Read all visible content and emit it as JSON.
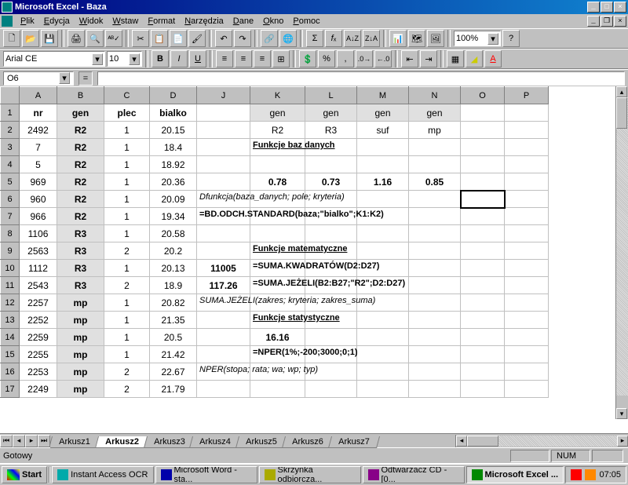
{
  "window": {
    "title": "Microsoft Excel - Baza"
  },
  "menu": {
    "items": [
      "Plik",
      "Edycja",
      "Widok",
      "Wstaw",
      "Format",
      "Narzędzia",
      "Dane",
      "Okno",
      "Pomoc"
    ]
  },
  "toolbar": {
    "font": "Arial CE",
    "size": "10",
    "zoom": "100%"
  },
  "formula": {
    "namebox": "O6",
    "formula": ""
  },
  "columns": [
    "A",
    "B",
    "C",
    "D",
    "J",
    "K",
    "L",
    "M",
    "N",
    "O",
    "P"
  ],
  "rows": [
    {
      "r": 1,
      "A": "nr",
      "B": "gen",
      "C": "plec",
      "D": "bialko",
      "K": "gen",
      "L": "gen",
      "M": "gen",
      "N": "gen",
      "hdr": true
    },
    {
      "r": 2,
      "A": "2492",
      "B": "R2",
      "C": "1",
      "D": "20.15",
      "K": "R2",
      "L": "R3",
      "M": "suf",
      "N": "mp"
    },
    {
      "r": 3,
      "A": "7",
      "B": "R2",
      "C": "1",
      "D": "18.4",
      "K": "Funkcje baz danych",
      "Kbu": true
    },
    {
      "r": 4,
      "A": "5",
      "B": "R2",
      "C": "1",
      "D": "18.92"
    },
    {
      "r": 5,
      "A": "969",
      "B": "R2",
      "C": "1",
      "D": "20.36",
      "K": "0.78",
      "L": "0.73",
      "M": "1.16",
      "N": "0.85",
      "Kb": true,
      "Lb": true,
      "Mb": true,
      "Nb": true
    },
    {
      "r": 6,
      "A": "960",
      "B": "R2",
      "C": "1",
      "D": "20.09",
      "J": "Dfunkcja(baza_danych; pole; kryteria)",
      "Ji": true,
      "sel": true
    },
    {
      "r": 7,
      "A": "966",
      "B": "R2",
      "C": "1",
      "D": "19.34",
      "J": "=BD.ODCH.STANDARD(baza;\"bialko\";K1:K2)",
      "Jb": true
    },
    {
      "r": 8,
      "A": "1106",
      "B": "R3",
      "C": "1",
      "D": "20.58"
    },
    {
      "r": 9,
      "A": "2563",
      "B": "R3",
      "C": "2",
      "D": "20.2",
      "K": "Funkcje matematyczne",
      "Kbu": true
    },
    {
      "r": 10,
      "A": "1112",
      "B": "R3",
      "C": "1",
      "D": "20.13",
      "J": "11005",
      "K": "=SUMA.KWADRATÓW(D2:D27)",
      "Jb": true,
      "Kb": true
    },
    {
      "r": 11,
      "A": "2543",
      "B": "R3",
      "C": "2",
      "D": "18.9",
      "J": "117.26",
      "K": "=SUMA.JEŻELI(B2:B27;\"R2\";D2:D27)",
      "Jb": true,
      "Kb": true
    },
    {
      "r": 12,
      "A": "2257",
      "B": "mp",
      "C": "1",
      "D": "20.82",
      "J": "SUMA.JEŻELI(zakres; kryteria; zakres_suma)",
      "Ji": true
    },
    {
      "r": 13,
      "A": "2252",
      "B": "mp",
      "C": "1",
      "D": "21.35",
      "K": "Funkcje statystyczne",
      "Kbu": true
    },
    {
      "r": 14,
      "A": "2259",
      "B": "mp",
      "C": "1",
      "D": "20.5",
      "K": "16.16",
      "Kb": true
    },
    {
      "r": 15,
      "A": "2255",
      "B": "mp",
      "C": "1",
      "D": "21.42",
      "K": "=NPER(1%;-200;3000;0;1)",
      "Kb": true
    },
    {
      "r": 16,
      "A": "2253",
      "B": "mp",
      "C": "2",
      "D": "22.67",
      "J": "NPER(stopa; rata; wa; wp; typ)",
      "Ji": true
    },
    {
      "r": 17,
      "A": "2249",
      "B": "mp",
      "C": "2",
      "D": "21.79"
    }
  ],
  "tabs": {
    "list": [
      "Arkusz1",
      "Arkusz2",
      "Arkusz3",
      "Arkusz4",
      "Arkusz5",
      "Arkusz6",
      "Arkusz7"
    ],
    "active": 1
  },
  "status": {
    "text": "Gotowy",
    "num": "NUM"
  },
  "taskbar": {
    "start": "Start",
    "buttons": [
      "Instant Access OCR",
      "Microsoft Word - sta...",
      "Skrzynka odbiorcza...",
      "Odtwarzacz CD - [0...",
      "Microsoft Excel ..."
    ],
    "active": 4,
    "clock": "07:05"
  }
}
